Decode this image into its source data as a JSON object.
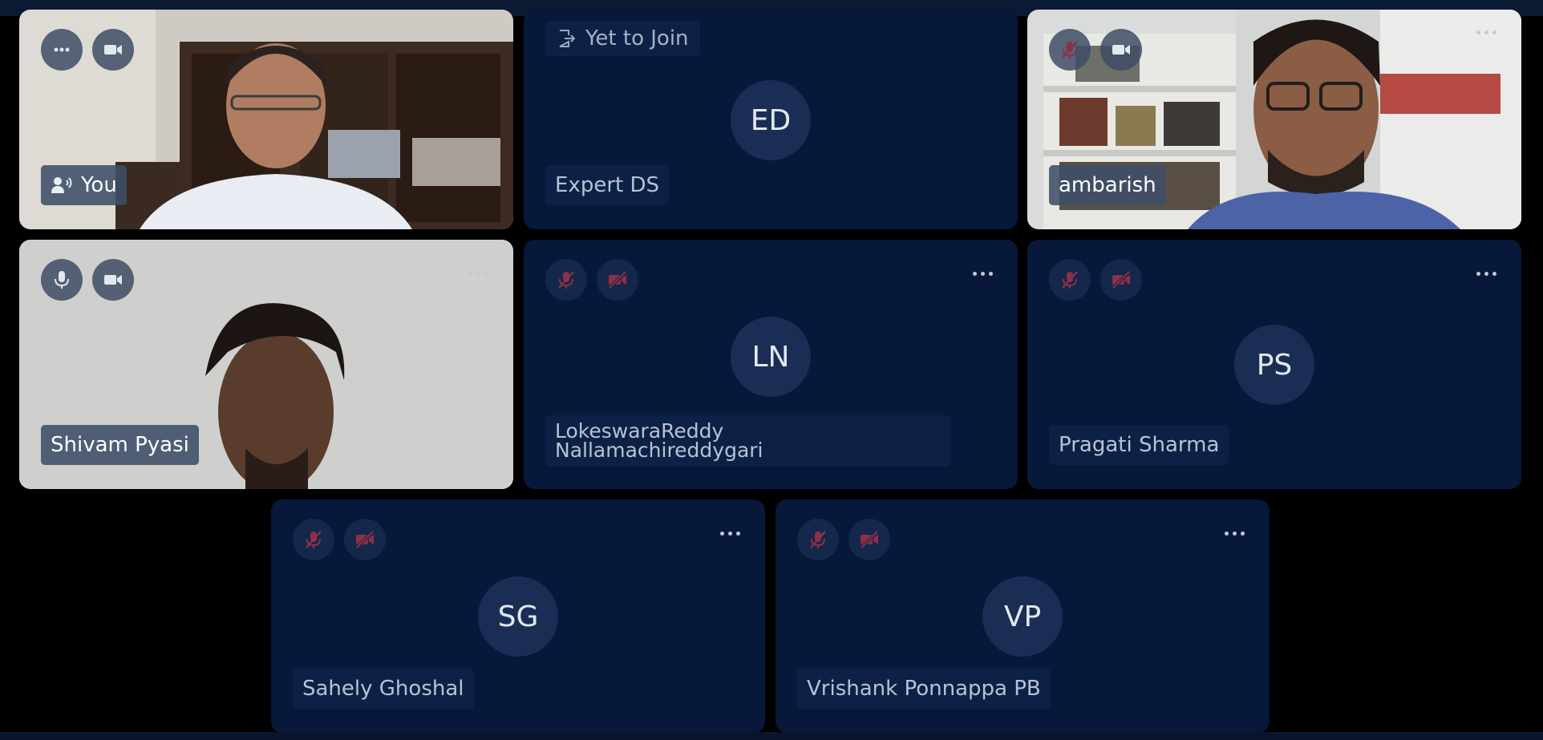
{
  "colors": {
    "background": "#000000",
    "tile_dark": "#07183a",
    "avatar_bg": "#1a2e55",
    "muted_icon": "#8e2f48",
    "control_icon": "#c8d0de"
  },
  "tiles": [
    {
      "id": "you",
      "label": "You",
      "type": "video",
      "mic": "speaking",
      "camera": "on"
    },
    {
      "id": "expert-ds",
      "label": "Expert DS",
      "initials": "ED",
      "type": "avatar",
      "status": "Yet to Join"
    },
    {
      "id": "ambarish",
      "label": "ambarish",
      "type": "video",
      "mic": "muted",
      "camera": "on"
    },
    {
      "id": "shivam-pyasi",
      "label": "Shivam Pyasi",
      "type": "video",
      "mic": "on",
      "camera": "on"
    },
    {
      "id": "lokeswarareddy",
      "label_line1": "LokeswaraReddy",
      "label_line2": "Nallamachireddygari",
      "initials": "LN",
      "type": "avatar",
      "mic": "muted",
      "camera": "off"
    },
    {
      "id": "pragati-sharma",
      "label": "Pragati Sharma",
      "initials": "PS",
      "type": "avatar",
      "mic": "muted",
      "camera": "off"
    },
    {
      "id": "sahely-ghoshal",
      "label": "Sahely Ghoshal",
      "initials": "SG",
      "type": "avatar",
      "mic": "muted",
      "camera": "off"
    },
    {
      "id": "vrishank-ponnappa",
      "label": "Vrishank Ponnappa PB",
      "initials": "VP",
      "type": "avatar",
      "mic": "muted",
      "camera": "off"
    }
  ]
}
